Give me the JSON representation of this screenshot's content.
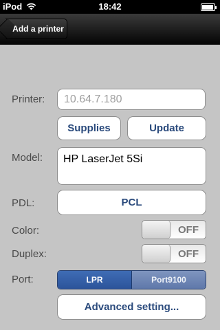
{
  "status_bar": {
    "carrier": "iPod",
    "time": "18:42"
  },
  "navbar": {
    "back_label": "Add a printer"
  },
  "form": {
    "printer": {
      "label": "Printer:",
      "placeholder": "10.64.7.180"
    },
    "supplies_button": "Supplies",
    "update_button": "Update",
    "model": {
      "label": "Model:",
      "value": "HP LaserJet 5Si"
    },
    "pdl": {
      "label": "PDL:",
      "value": "PCL"
    },
    "color": {
      "label": "Color:",
      "state": "OFF"
    },
    "duplex": {
      "label": "Duplex:",
      "state": "OFF"
    },
    "port": {
      "label": "Port:",
      "options": [
        "LPR",
        "Port9100"
      ],
      "selected": "LPR"
    },
    "advanced_button": "Advanced setting..."
  },
  "colors": {
    "accent_text": "#2a4a7c",
    "segment_selected": "#3f6cb5",
    "background": "#c5c5c5"
  }
}
